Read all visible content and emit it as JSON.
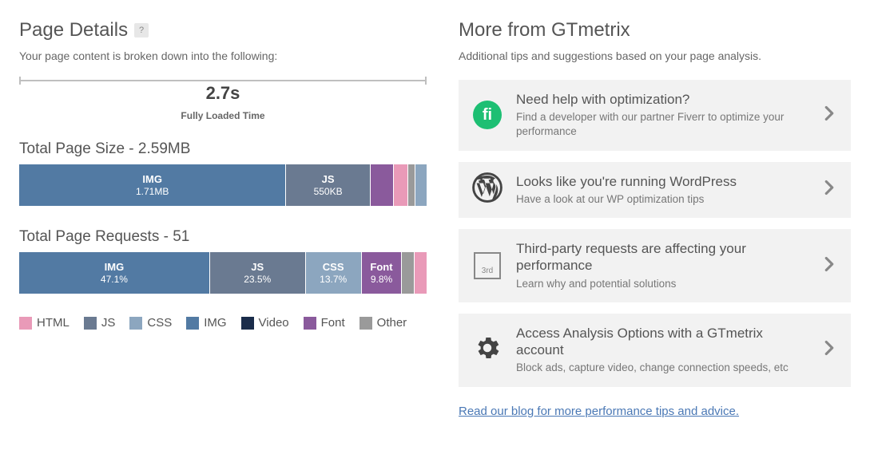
{
  "left": {
    "title": "Page Details",
    "help": "?",
    "subtitle": "Your page content is broken down into the following:",
    "load_time_value": "2.7s",
    "load_time_label": "Fully Loaded Time",
    "size_title": "Total Page Size - 2.59MB",
    "requests_title": "Total Page Requests - 51",
    "legend": {
      "html": "HTML",
      "js": "JS",
      "css": "CSS",
      "img": "IMG",
      "video": "Video",
      "font": "Font",
      "other": "Other"
    }
  },
  "chart_data": [
    {
      "type": "bar",
      "title": "Total Page Size - 2.59MB",
      "unit": "bytes",
      "total_display": "2.59MB",
      "series": [
        {
          "name": "IMG",
          "display": "1.71MB",
          "percent": 66.0,
          "color": "#527aa3"
        },
        {
          "name": "JS",
          "display": "550KB",
          "percent": 20.7,
          "color": "#6a7a91"
        },
        {
          "name": "Font",
          "display": "",
          "percent": 5.5,
          "color": "#8a5a9c"
        },
        {
          "name": "HTML",
          "display": "",
          "percent": 3.5,
          "color": "#e99ab8"
        },
        {
          "name": "Other",
          "display": "",
          "percent": 1.5,
          "color": "#9a9a9a"
        },
        {
          "name": "CSS",
          "display": "",
          "percent": 2.8,
          "color": "#8ca6bf"
        }
      ]
    },
    {
      "type": "bar",
      "title": "Total Page Requests - 51",
      "unit": "requests",
      "total_display": "51",
      "series": [
        {
          "name": "IMG",
          "display": "47.1%",
          "percent": 47.1,
          "color": "#527aa3"
        },
        {
          "name": "JS",
          "display": "23.5%",
          "percent": 23.5,
          "color": "#6a7a91"
        },
        {
          "name": "CSS",
          "display": "13.7%",
          "percent": 13.7,
          "color": "#8ca6bf"
        },
        {
          "name": "Font",
          "display": "9.8%",
          "percent": 9.8,
          "color": "#8a5a9c"
        },
        {
          "name": "Other",
          "display": "",
          "percent": 3.0,
          "color": "#9a9a9a"
        },
        {
          "name": "HTML",
          "display": "",
          "percent": 2.9,
          "color": "#e99ab8"
        }
      ]
    }
  ],
  "right": {
    "title": "More from GTmetrix",
    "subtitle": "Additional tips and suggestions based on your page analysis.",
    "items": [
      {
        "icon": "fiverr-icon",
        "title": "Need help with optimization?",
        "desc": "Find a developer with our partner Fiverr to optimize your performance"
      },
      {
        "icon": "wordpress-icon",
        "title": "Looks like you're running WordPress",
        "desc": "Have a look at our WP optimization tips"
      },
      {
        "icon": "third-party-icon",
        "title": "Third-party requests are affecting your performance",
        "desc": "Learn why and potential solutions"
      },
      {
        "icon": "gear-icon",
        "title": "Access Analysis Options with a GTmetrix account",
        "desc": "Block ads, capture video, change connection speeds, etc"
      }
    ],
    "blog_link": "Read our blog for more performance tips and advice."
  }
}
